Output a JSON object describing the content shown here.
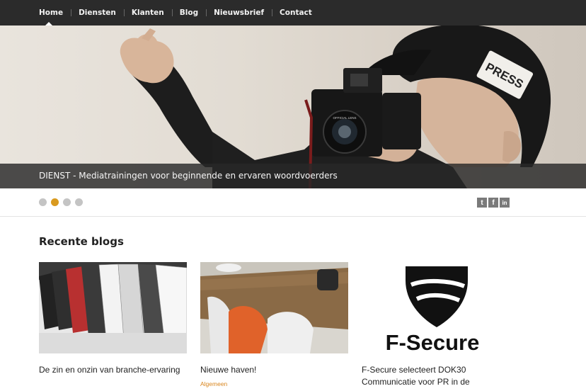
{
  "nav": {
    "items": [
      {
        "label": "Home"
      },
      {
        "label": "Diensten"
      },
      {
        "label": "Klanten"
      },
      {
        "label": "Blog"
      },
      {
        "label": "Nieuwsbrief"
      },
      {
        "label": "Contact"
      }
    ]
  },
  "hero": {
    "caption": "DIENST - Mediatrainingen voor beginnende en ervaren woordvoerders",
    "hat_text": "PRESS",
    "camera_text": "OFFICIAL LENS"
  },
  "slider": {
    "active_index": 1,
    "count": 4
  },
  "social": {
    "twitter": "t",
    "facebook": "f",
    "linkedin": "in"
  },
  "blogs": {
    "heading": "Recente blogs",
    "items": [
      {
        "title": "De zin en onzin van branche-ervaring",
        "category": ""
      },
      {
        "title": "Nieuwe haven!",
        "category": "Algemeen"
      },
      {
        "title": "F-Secure selecteert DOK30 Communicatie voor PR in de",
        "category": ""
      }
    ],
    "logo_text": "F-Secure"
  },
  "colors": {
    "nav_bg": "#2b2b2b",
    "accent": "#d99a1f",
    "category": "#d9861f"
  }
}
